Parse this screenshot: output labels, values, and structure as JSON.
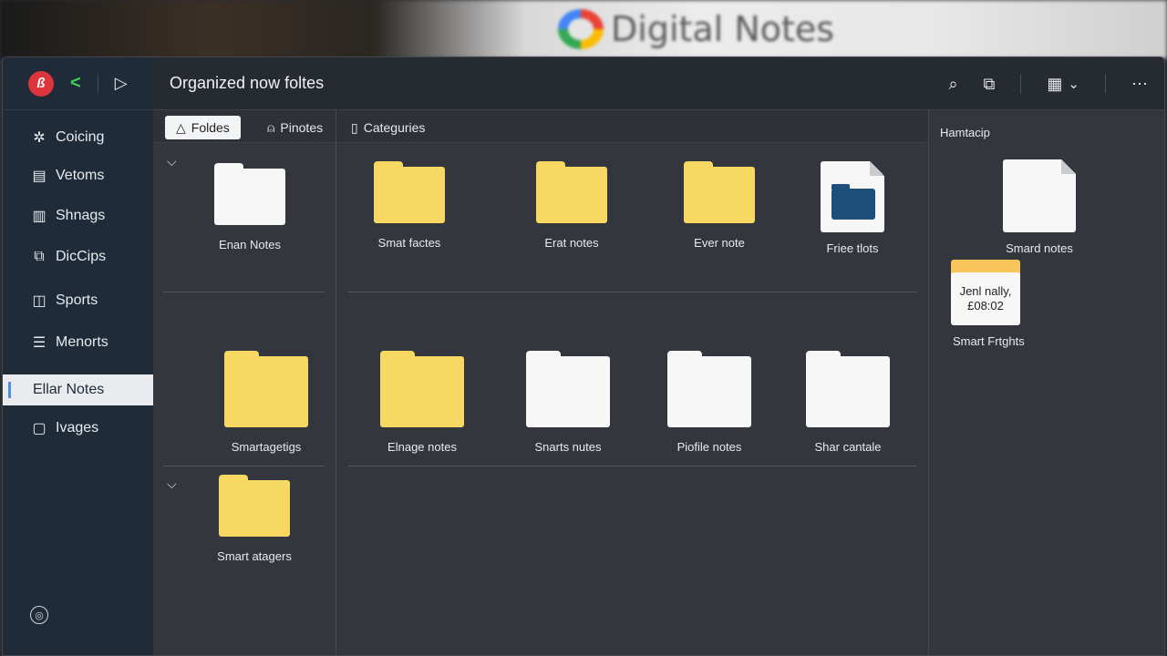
{
  "banner": {
    "title": "Digital Notes",
    "logo_icon": "g-logo"
  },
  "app": {
    "title": "Organized now foltes",
    "accent": "#4a90e2",
    "brand": "#e0343d"
  },
  "sidebar": {
    "items": [
      {
        "label": "Coicing",
        "icon": "gear-icon"
      },
      {
        "label": "Vetoms",
        "icon": "server-icon"
      },
      {
        "label": "Shnags",
        "icon": "chart-icon"
      },
      {
        "label": "DicCips",
        "icon": "clip-icon"
      },
      {
        "label": "Sports",
        "icon": "book-icon"
      },
      {
        "label": "Menorts",
        "icon": "list-icon"
      },
      {
        "label": "Ellar Notes",
        "icon": "",
        "active": true
      },
      {
        "label": "Ivages",
        "icon": "image-icon"
      }
    ]
  },
  "tabs": [
    {
      "label": "Foldes",
      "icon": "triangle-icon"
    },
    {
      "label": "Pinotes",
      "icon": "person-icon"
    },
    {
      "label": "Categuries",
      "icon": "doc-icon"
    }
  ],
  "left_col": {
    "items": [
      {
        "label": "Enan Notes",
        "kind": "white"
      },
      {
        "label": "Smartagetigs",
        "kind": "yellow"
      },
      {
        "label": "Smart atagers",
        "kind": "yellow"
      }
    ]
  },
  "grid": {
    "row1": [
      {
        "label": "Smat factes",
        "kind": "yellow"
      },
      {
        "label": "Erat notes",
        "kind": "yellow"
      },
      {
        "label": "Ever note",
        "kind": "yellow"
      },
      {
        "label": "Friee tlots",
        "kind": "doc"
      }
    ],
    "row2": [
      {
        "label": "Elnage notes",
        "kind": "yellow"
      },
      {
        "label": "Snarts nutes",
        "kind": "white"
      },
      {
        "label": "Piofile notes",
        "kind": "white"
      },
      {
        "label": "Shar cantale",
        "kind": "white"
      }
    ]
  },
  "right_panel": {
    "header": "Hamtacip",
    "item": {
      "label": "Smard notes",
      "kind": "white"
    },
    "card": {
      "line1": "Jenl nally,",
      "line2": "£08:02",
      "label": "Smart Frtghts"
    }
  }
}
